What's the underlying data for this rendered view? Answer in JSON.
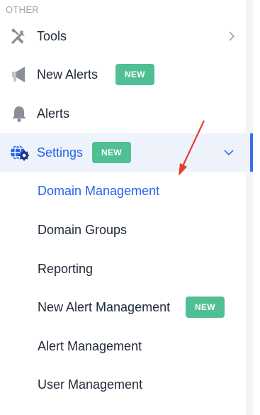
{
  "section": {
    "label": "OTHER"
  },
  "nav": {
    "tools": {
      "label": "Tools",
      "icon": "tools-icon"
    },
    "new_alerts": {
      "label": "New Alerts",
      "badge": "NEW",
      "icon": "megaphone-icon"
    },
    "alerts": {
      "label": "Alerts",
      "icon": "bell-icon"
    },
    "settings": {
      "label": "Settings",
      "badge": "NEW",
      "icon": "settings-globe-icon"
    }
  },
  "settings_submenu": [
    {
      "label": "Domain Management",
      "active": true
    },
    {
      "label": "Domain Groups"
    },
    {
      "label": "Reporting"
    },
    {
      "label": "New Alert Management",
      "badge": "NEW"
    },
    {
      "label": "Alert Management"
    },
    {
      "label": "User Management"
    }
  ],
  "colors": {
    "badge": "#4fbf94",
    "active_text": "#2563eb",
    "active_bg": "#eef3fb",
    "active_bar": "#3b6cf0",
    "annotation_arrow": "#e53e2e"
  }
}
